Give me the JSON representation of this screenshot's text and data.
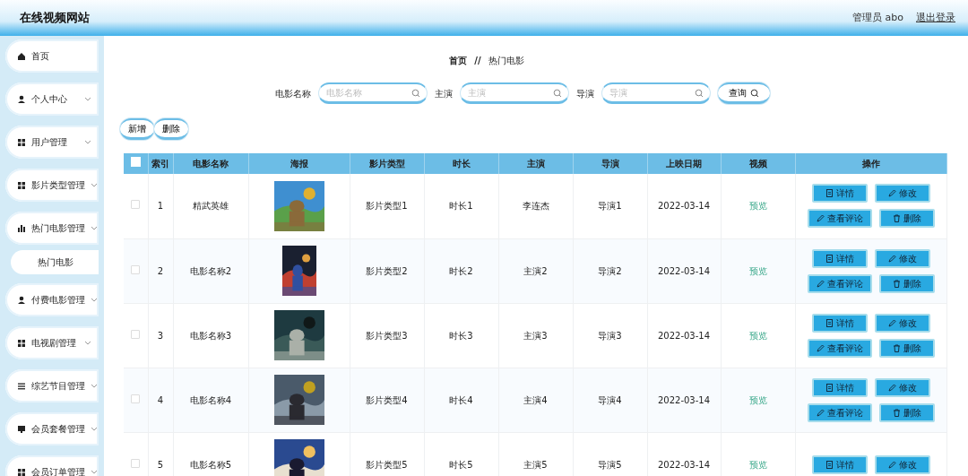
{
  "header": {
    "title": "在线视频网站",
    "user": "管理员 abo",
    "logout": "退出登录"
  },
  "sidebar": {
    "items": [
      {
        "label": "首页",
        "kind": "home"
      },
      {
        "label": "个人中心",
        "kind": "user"
      },
      {
        "label": "用户管理",
        "kind": "grid"
      },
      {
        "label": "影片类型管理",
        "kind": "grid"
      },
      {
        "label": "热门电影管理",
        "kind": "chart",
        "children": [
          {
            "label": "热门电影"
          }
        ]
      },
      {
        "label": "付费电影管理",
        "kind": "user"
      },
      {
        "label": "电视剧管理",
        "kind": "grid"
      },
      {
        "label": "综艺节目管理",
        "kind": "list"
      },
      {
        "label": "会员套餐管理",
        "kind": "monitor"
      },
      {
        "label": "会员订单管理",
        "kind": "grid"
      }
    ]
  },
  "breadcrumb": {
    "home": "首页",
    "separator": "//",
    "current": "热门电影"
  },
  "search": {
    "fields": [
      {
        "label": "电影名称",
        "placeholder": "电影名称"
      },
      {
        "label": "主演",
        "placeholder": "主演"
      },
      {
        "label": "导演",
        "placeholder": "导演"
      }
    ],
    "button": "查询"
  },
  "toolbar": {
    "buttons": [
      "新增",
      "删除"
    ]
  },
  "table": {
    "header_checkbox": {
      "checked": false
    },
    "columns": [
      "索引",
      "电影名称",
      "海报",
      "影片类型",
      "时长",
      "主演",
      "导演",
      "上映日期",
      "视频",
      "操作"
    ],
    "rows": [
      {
        "checked": false,
        "index": "1",
        "name": "精武英雄",
        "poster": {
          "kind": "picture"
        },
        "type": "影片类型1",
        "duration": "时长1",
        "actor": "李连杰",
        "director": "导演1",
        "date": "2022-03-14",
        "video": "预览",
        "actions": [
          {
            "label": "详情",
            "kind": "detail"
          },
          {
            "label": "修改",
            "kind": "edit"
          },
          {
            "label": "查看评论",
            "kind": "edit"
          },
          {
            "label": "删除",
            "kind": "delete"
          }
        ]
      },
      {
        "checked": false,
        "index": "2",
        "name": "电影名称2",
        "poster": {
          "kind": "picture"
        },
        "type": "影片类型2",
        "duration": "时长2",
        "actor": "主演2",
        "director": "导演2",
        "date": "2022-03-14",
        "video": "预览",
        "actions": [
          {
            "label": "详情",
            "kind": "detail"
          },
          {
            "label": "修改",
            "kind": "edit"
          },
          {
            "label": "查看评论",
            "kind": "edit"
          },
          {
            "label": "删除",
            "kind": "delete"
          }
        ]
      },
      {
        "checked": false,
        "index": "3",
        "name": "电影名称3",
        "poster": {
          "kind": "picture"
        },
        "type": "影片类型3",
        "duration": "时长3",
        "actor": "主演3",
        "director": "导演3",
        "date": "2022-03-14",
        "video": "预览",
        "actions": [
          {
            "label": "详情",
            "kind": "detail"
          },
          {
            "label": "修改",
            "kind": "edit"
          },
          {
            "label": "查看评论",
            "kind": "edit"
          },
          {
            "label": "删除",
            "kind": "delete"
          }
        ]
      },
      {
        "checked": false,
        "index": "4",
        "name": "电影名称4",
        "poster": {
          "kind": "picture"
        },
        "type": "影片类型4",
        "duration": "时长4",
        "actor": "主演4",
        "director": "导演4",
        "date": "2022-03-14",
        "video": "预览",
        "actions": [
          {
            "label": "详情",
            "kind": "detail"
          },
          {
            "label": "修改",
            "kind": "edit"
          },
          {
            "label": "查看评论",
            "kind": "edit"
          },
          {
            "label": "删除",
            "kind": "delete"
          }
        ]
      },
      {
        "checked": false,
        "index": "5",
        "name": "电影名称5",
        "poster": {
          "kind": "picture"
        },
        "type": "影片类型5",
        "duration": "时长5",
        "actor": "主演5",
        "director": "导演5",
        "date": "2022-03-14",
        "video": "预览",
        "actions": [
          {
            "label": "详情",
            "kind": "detail"
          },
          {
            "label": "修改",
            "kind": "edit"
          }
        ]
      }
    ]
  }
}
